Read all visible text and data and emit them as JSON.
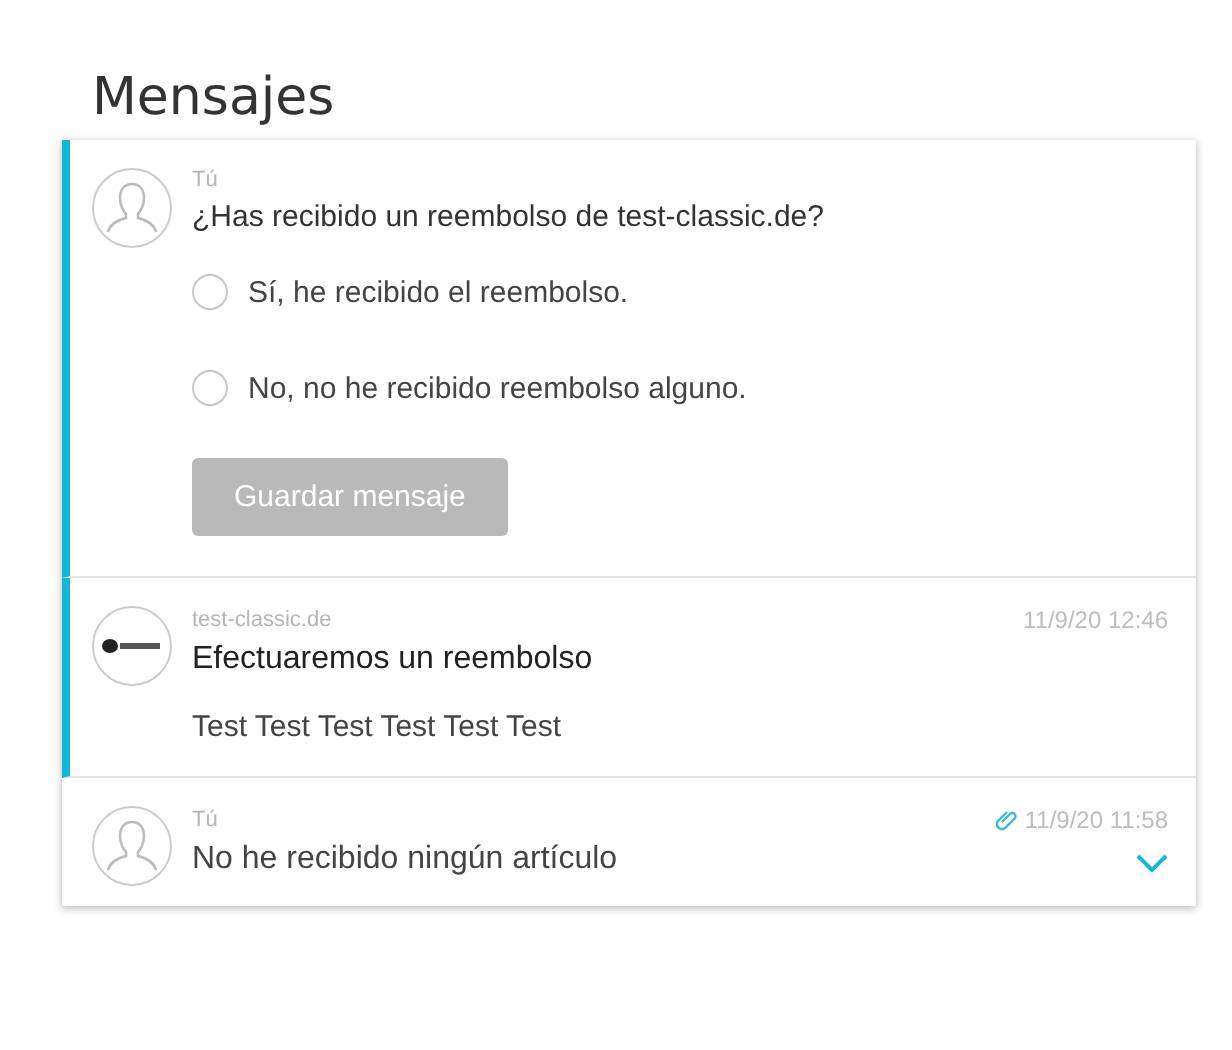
{
  "title": "Mensajes",
  "messages": [
    {
      "kind": "question",
      "highlighted": true,
      "avatar": {
        "kind": "person"
      },
      "sender": "Tú",
      "text": "¿Has recibido un reembolso de test-classic.de?",
      "options": [
        {
          "label": "Sí, he recibido el reembolso.",
          "selected": false
        },
        {
          "label": "No, no he recibido reembolso alguno.",
          "selected": false
        }
      ],
      "button": {
        "label": "Guardar mensaje",
        "disabled": true
      }
    },
    {
      "kind": "message",
      "highlighted": true,
      "avatar": {
        "kind": "logo"
      },
      "sender": "test-classic.de",
      "time": "11/9/20 12:46",
      "subject": "Efectuaremos un reembolso",
      "body": "Test Test Test Test Test Test",
      "attachment": false
    },
    {
      "kind": "collapsed",
      "highlighted": false,
      "avatar": {
        "kind": "person"
      },
      "sender": "Tú",
      "time": "11/9/20 11:58",
      "subject": "No he recibido ningún artículo",
      "attachment": true,
      "expanded": false
    }
  ]
}
